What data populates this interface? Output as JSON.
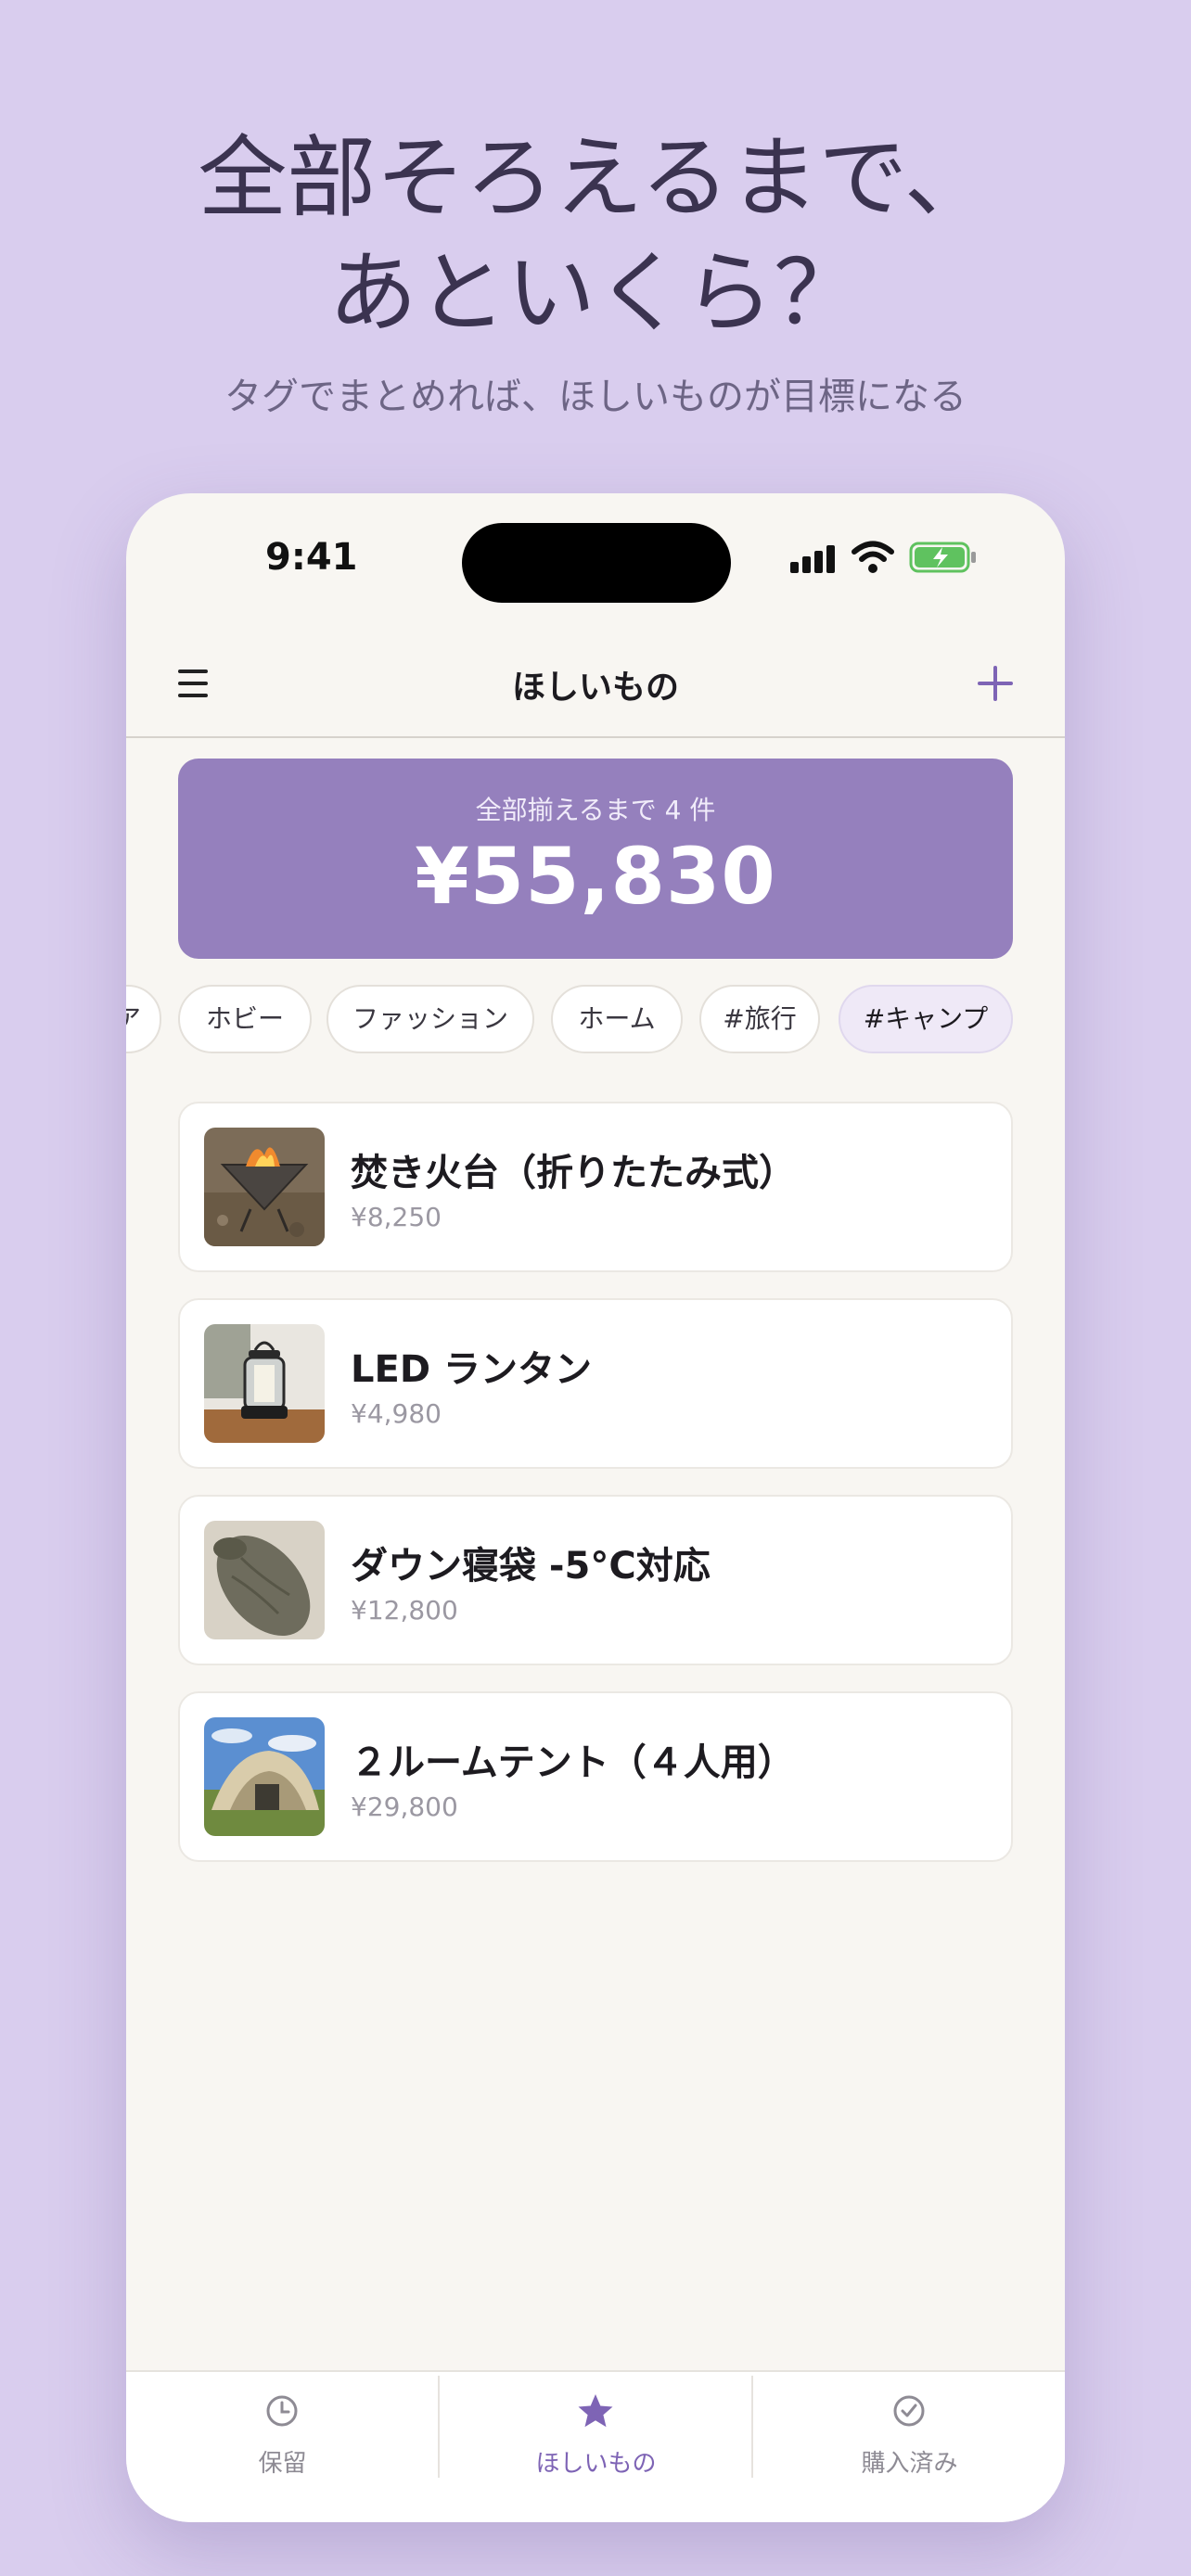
{
  "hero": {
    "headline_line1": "全部そろえるまで、",
    "headline_line2": "あといくら？",
    "subline": "タグでまとめれば、ほしいものが目標になる"
  },
  "status_bar": {
    "time": "9:41"
  },
  "navbar": {
    "title": "ほしいもの",
    "menu_icon": "hamburger-icon",
    "add_icon": "plus-icon"
  },
  "summary": {
    "label": "全部揃えるまで 4 件",
    "amount": "¥55,830"
  },
  "tags": [
    {
      "label": "ア",
      "active": false
    },
    {
      "label": "ホビー",
      "active": false
    },
    {
      "label": "ファッション",
      "active": false
    },
    {
      "label": "ホーム",
      "active": false
    },
    {
      "label": "#旅行",
      "active": false
    },
    {
      "label": "#キャンプ",
      "active": true
    }
  ],
  "items": [
    {
      "title": "焚き火台（折りたたみ式）",
      "price": "¥8,250"
    },
    {
      "title": "LED ランタン",
      "price": "¥4,980"
    },
    {
      "title": "ダウン寝袋 -5°C対応",
      "price": "¥12,800"
    },
    {
      "title": "２ルームテント（４人用）",
      "price": "¥29,800"
    }
  ],
  "tabbar": [
    {
      "label": "保留",
      "icon": "clock-icon",
      "active": false
    },
    {
      "label": "ほしいもの",
      "icon": "star-icon",
      "active": true
    },
    {
      "label": "購入済み",
      "icon": "check-circle-icon",
      "active": false
    }
  ],
  "colors": {
    "background": "#d9cdee",
    "accent": "#7e64b5",
    "summary_card": "#9580bd"
  }
}
